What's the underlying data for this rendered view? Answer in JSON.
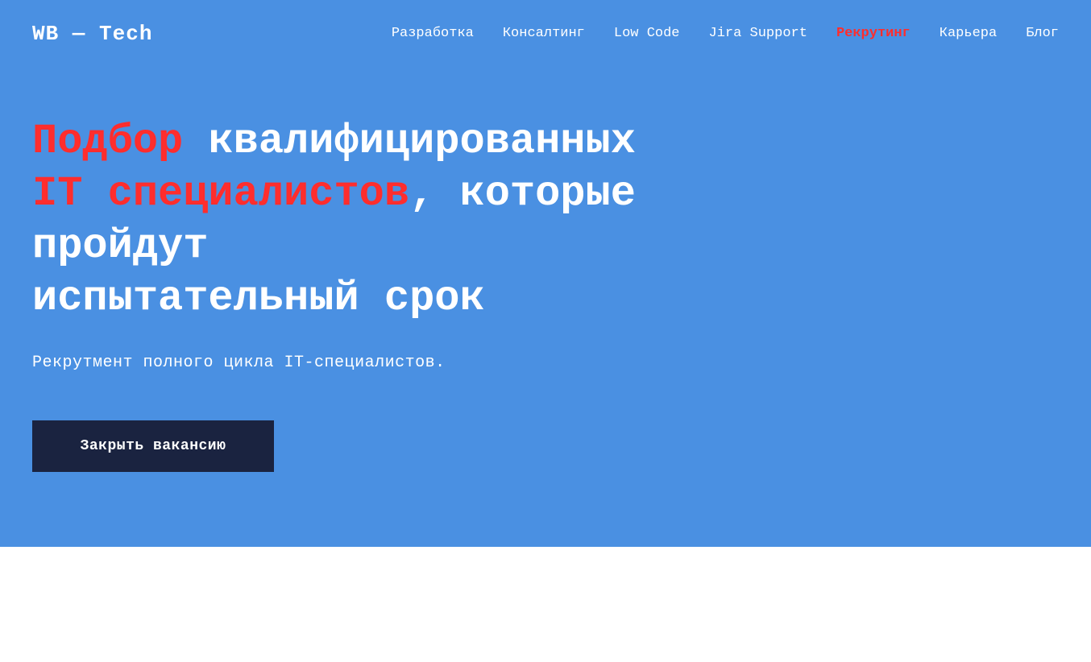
{
  "logo": {
    "text": "WB — Tech"
  },
  "nav": {
    "items": [
      {
        "id": "razrabotka",
        "label": "Разработка",
        "active": false
      },
      {
        "id": "konsalting",
        "label": "Консалтинг",
        "active": false
      },
      {
        "id": "low-code",
        "label": "Low Code",
        "active": false
      },
      {
        "id": "jira-support",
        "label": "Jira Support",
        "active": false
      },
      {
        "id": "rekruting",
        "label": "Рекрутинг",
        "active": true
      },
      {
        "id": "karera",
        "label": "Карьера",
        "active": false
      },
      {
        "id": "blog",
        "label": "Блог",
        "active": false
      }
    ]
  },
  "hero": {
    "title_part1_red": "Подбор",
    "title_part1_white": " квалифицированных",
    "title_part2_red": "IT специалистов",
    "title_part2_white": ", которые пройдут",
    "title_part3_white": "испытательный срок",
    "subtitle": "Рекрутмент полного цикла IT-специалистов.",
    "cta_label": "Закрыть вакансию"
  },
  "colors": {
    "background_blue": "#4a90e2",
    "red_accent": "#ff2d2d",
    "dark_button": "#1a2340",
    "white": "#ffffff"
  }
}
